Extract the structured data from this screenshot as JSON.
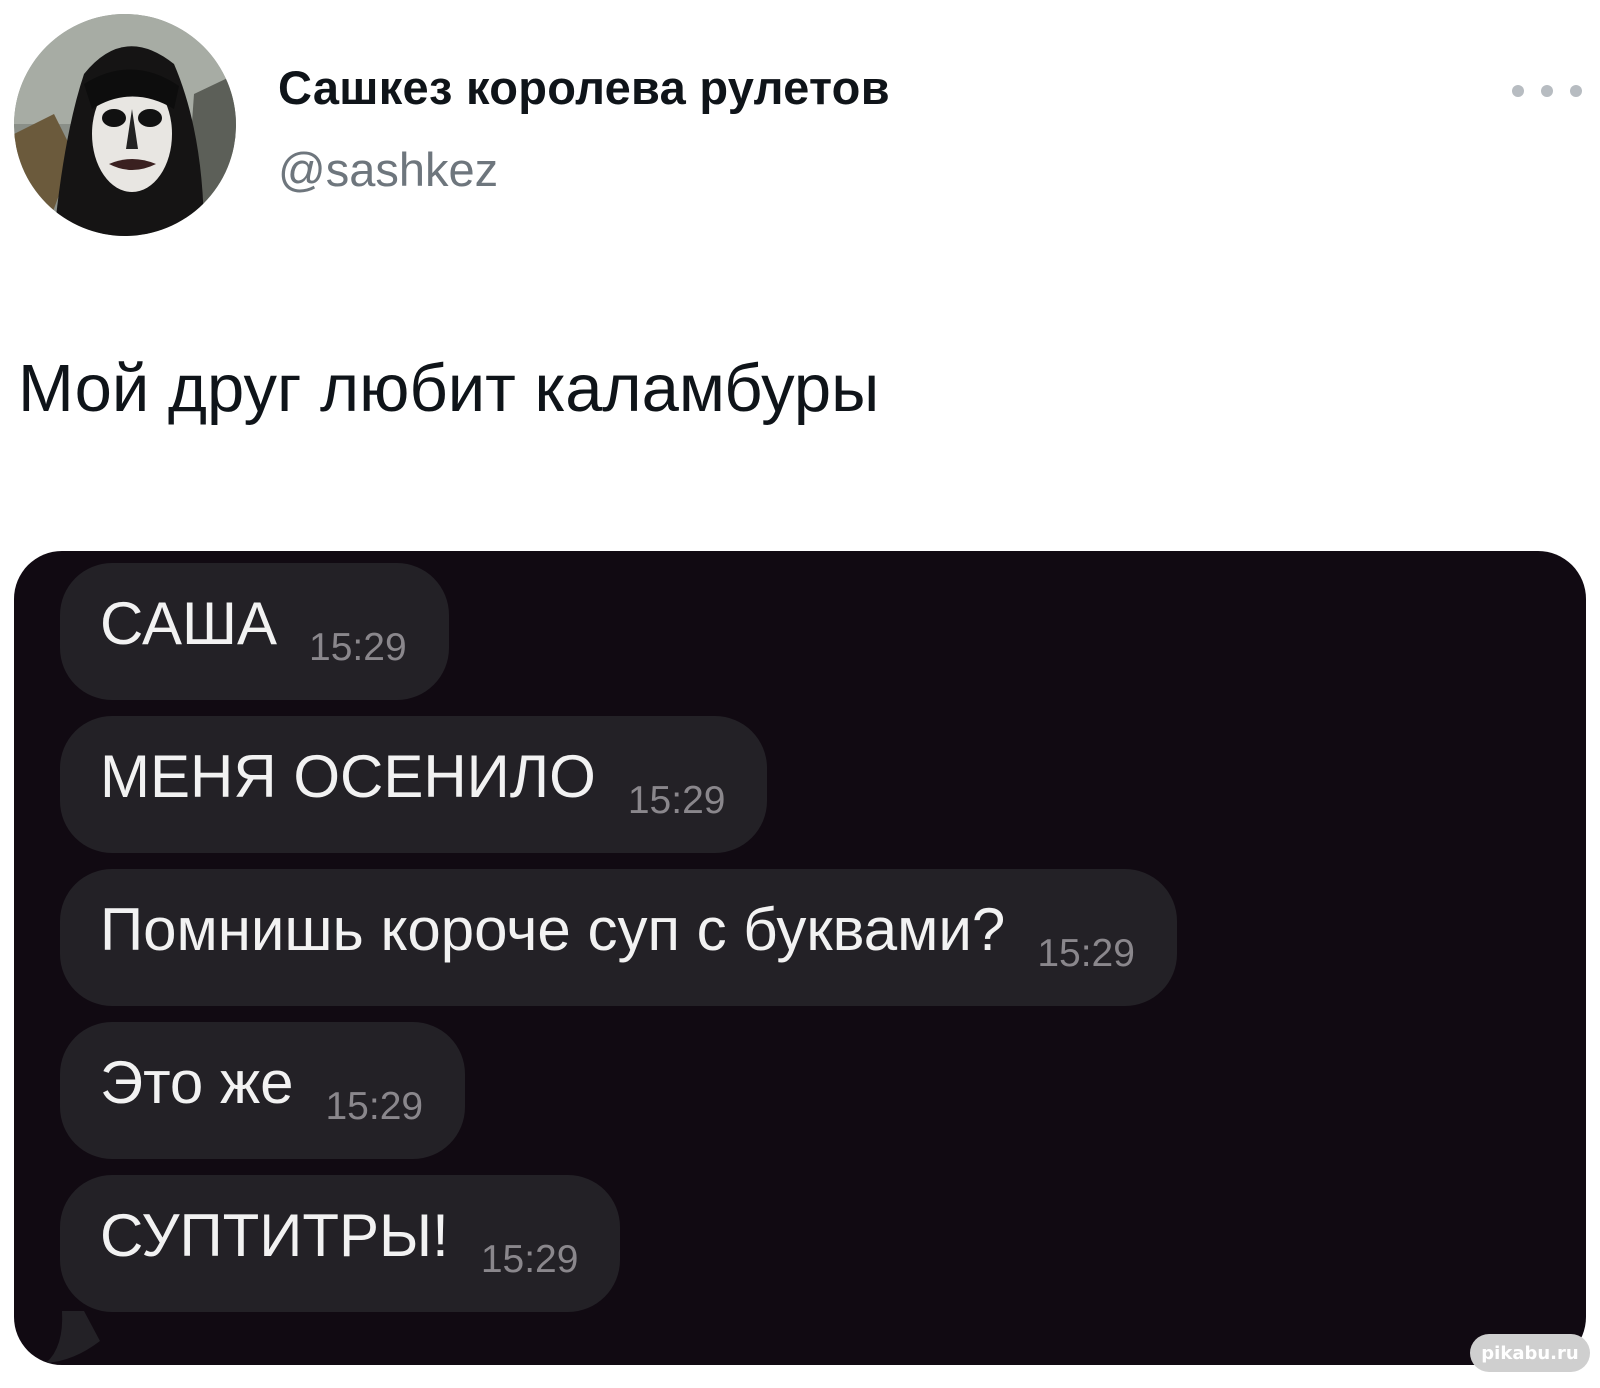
{
  "tweet": {
    "author": {
      "display_name": "Сашкез королева рулетов",
      "handle": "@sashkez",
      "avatar_icon": "avatar-photo"
    },
    "more_icon": "more-horizontal-icon",
    "text": "Мой друг любит каламбуры"
  },
  "chat": {
    "messages": [
      {
        "text": "САША",
        "time": "15:29"
      },
      {
        "text": "МЕНЯ ОСЕНИЛО",
        "time": "15:29"
      },
      {
        "text": "Помнишь короче суп с буквами?",
        "time": "15:29"
      },
      {
        "text": "Это же",
        "time": "15:29"
      },
      {
        "text": "СУПТИТРЫ!",
        "time": "15:29"
      }
    ]
  },
  "watermark": "pikabu.ru",
  "colors": {
    "chat_background": "#110a12",
    "bubble": "#232126",
    "bubble_text": "#f2f2f2",
    "time_text": "#8a878c",
    "handle_text": "#6e767d"
  }
}
